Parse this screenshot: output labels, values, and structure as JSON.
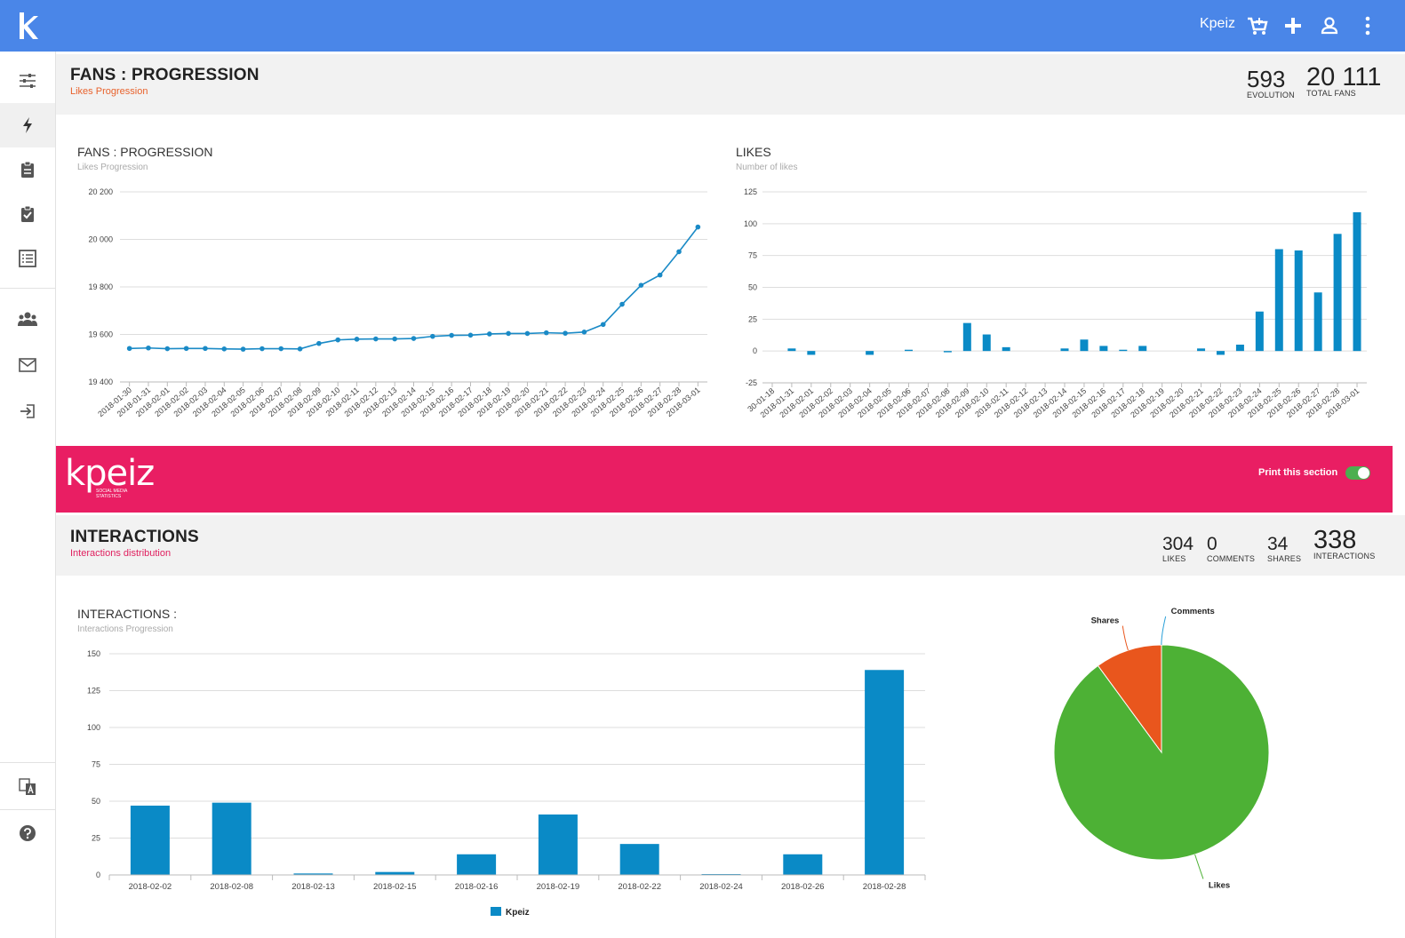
{
  "topbar": {
    "user": "Kpeiz",
    "icons": [
      "cart-plus-icon",
      "plus-icon",
      "user-icon",
      "more-vert-icon"
    ],
    "color": "#4a86e8"
  },
  "sidebar": {
    "items": [
      "sliders-icon",
      "lightning-icon",
      "clipboard-icon",
      "clipboard-check-icon",
      "list-icon",
      "users-icon",
      "mail-icon",
      "sign-in-icon",
      "translate-icon",
      "help-icon"
    ]
  },
  "fans": {
    "title": "FANS : PROGRESSION",
    "subtitle": "Likes Progression",
    "kpis": [
      {
        "value": "593",
        "label": "EVOLUTION"
      },
      {
        "value": "20 111",
        "label": "TOTAL FANS"
      }
    ]
  },
  "line_chart": {
    "title": "FANS : PROGRESSION",
    "subtitle": "Likes Progression"
  },
  "likes_chart": {
    "title": "LIKES",
    "subtitle": "Number of likes"
  },
  "banner": {
    "brand": "kpeiz",
    "tagline": [
      "SOCIAL MEDIA",
      "STATISTICS"
    ],
    "print_label": "Print this section",
    "print_enabled": true,
    "color": "#e91e63"
  },
  "interactions": {
    "title": "INTERACTIONS",
    "subtitle": "Interactions distribution",
    "kpis": [
      {
        "value": "304",
        "label": "LIKES"
      },
      {
        "value": "0",
        "label": "COMMENTS"
      },
      {
        "value": "34",
        "label": "SHARES"
      },
      {
        "value": "338",
        "label": "INTERACTIONS"
      }
    ]
  },
  "interactions_chart": {
    "title": "INTERACTIONS :",
    "subtitle": "Interactions Progression"
  },
  "chart_data": [
    {
      "type": "line",
      "x": [
        "2018-01-30",
        "2018-01-31",
        "2018-02-01",
        "2018-02-02",
        "2018-02-03",
        "2018-02-04",
        "2018-02-05",
        "2018-02-06",
        "2018-02-07",
        "2018-02-08",
        "2018-02-09",
        "2018-02-10",
        "2018-02-11",
        "2018-02-12",
        "2018-02-13",
        "2018-02-14",
        "2018-02-15",
        "2018-02-16",
        "2018-02-17",
        "2018-02-18",
        "2018-02-19",
        "2018-02-20",
        "2018-02-21",
        "2018-02-22",
        "2018-02-23",
        "2018-02-24",
        "2018-02-25",
        "2018-02-26",
        "2018-02-27",
        "2018-02-28",
        "2018-03-01"
      ],
      "series": [
        {
          "values": [
            19541,
            19543,
            19540,
            19541,
            19541,
            19539,
            19538,
            19540,
            19540,
            19539,
            19562,
            19577,
            19580,
            19581,
            19581,
            19583,
            19592,
            19596,
            19597,
            19602,
            19604,
            19604,
            19607,
            19605,
            19610,
            19642,
            19727,
            19807,
            19850,
            19948,
            20052
          ]
        }
      ],
      "ylim": [
        19400,
        20200
      ],
      "yticks": [
        "19 400",
        "19 600",
        "19 800",
        "20 000",
        "20 200"
      ],
      "color": "#1a8ac6"
    },
    {
      "type": "bar",
      "categories": [
        "30-01-18",
        "2018-01-31",
        "2018-02-01",
        "2018-02-02",
        "2018-02-03",
        "2018-02-04",
        "2018-02-05",
        "2018-02-06",
        "2018-02-07",
        "2018-02-08",
        "2018-02-09",
        "2018-02-10",
        "2018-02-11",
        "2018-02-12",
        "2018-02-13",
        "2018-02-14",
        "2018-02-15",
        "2018-02-16",
        "2018-02-17",
        "2018-02-18",
        "2018-02-19",
        "2018-02-20",
        "2018-02-21",
        "2018-02-22",
        "2018-02-23",
        "2018-02-24",
        "2018-02-25",
        "2018-02-26",
        "2018-02-27",
        "2018-02-28",
        "2018-03-01"
      ],
      "values": [
        0,
        2,
        -3,
        0,
        0,
        -3,
        0,
        1,
        0,
        -1,
        22,
        13,
        3,
        0,
        0,
        2,
        9,
        4,
        1,
        4,
        0,
        0,
        2,
        -3,
        5,
        31,
        80,
        79,
        46,
        92,
        109
      ],
      "ylim": [
        -25,
        125
      ],
      "yticks": [
        "-25",
        "0",
        "25",
        "50",
        "75",
        "100",
        "125"
      ],
      "color": "#0a8ac6"
    },
    {
      "type": "bar",
      "categories": [
        "2018-02-02",
        "2018-02-08",
        "2018-02-13",
        "2018-02-15",
        "2018-02-16",
        "2018-02-19",
        "2018-02-22",
        "2018-02-24",
        "2018-02-26",
        "2018-02-28"
      ],
      "series": [
        {
          "name": "Kpeiz",
          "values": [
            47,
            49,
            1,
            2,
            14,
            41,
            21,
            0,
            14,
            139
          ]
        }
      ],
      "ylim": [
        0,
        150
      ],
      "yticks": [
        "0",
        "25",
        "50",
        "75",
        "100",
        "125",
        "150"
      ],
      "color": "#0a8ac6"
    },
    {
      "type": "pie",
      "labels": [
        "Likes",
        "Shares",
        "Comments"
      ],
      "values": [
        304,
        34,
        0
      ],
      "colors": [
        "#4db135",
        "#e9561d",
        "#2aa0d8"
      ]
    }
  ]
}
